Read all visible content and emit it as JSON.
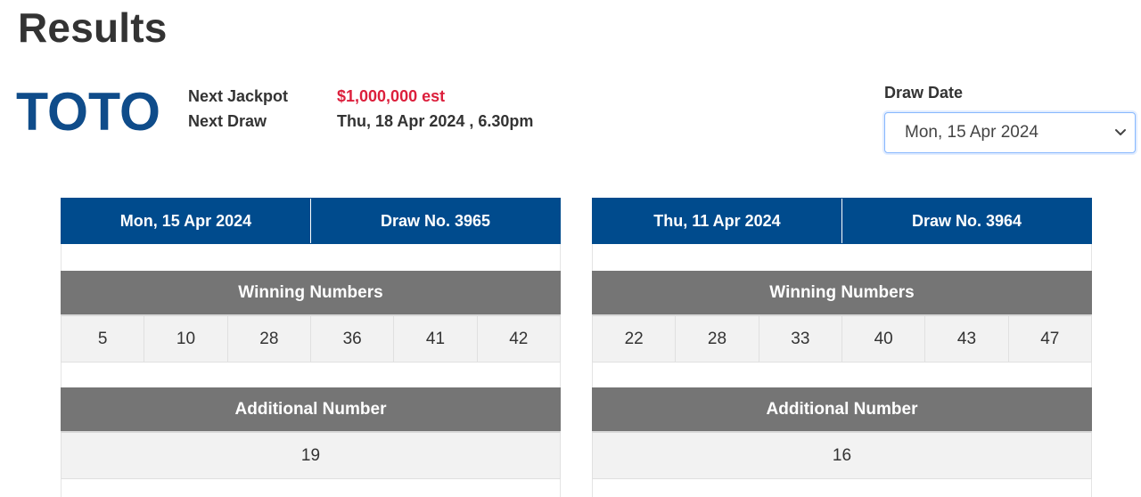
{
  "page": {
    "title": "Results"
  },
  "brand": {
    "logo_text": "TOTO",
    "color": "#0f4c8a"
  },
  "info": {
    "next_jackpot_label": "Next Jackpot",
    "next_jackpot_value": "$1,000,000 est",
    "next_draw_label": "Next Draw",
    "next_draw_value": "Thu, 18 Apr 2024 , 6.30pm"
  },
  "draw_date": {
    "label": "Draw Date",
    "selected": "Mon, 15 Apr 2024"
  },
  "draws": [
    {
      "date": "Mon, 15 Apr 2024",
      "draw_no": "Draw No. 3965",
      "winning_label": "Winning Numbers",
      "winning_numbers": [
        "5",
        "10",
        "28",
        "36",
        "41",
        "42"
      ],
      "additional_label": "Additional Number",
      "additional_number": "19"
    },
    {
      "date": "Thu, 11 Apr 2024",
      "draw_no": "Draw No. 3964",
      "winning_label": "Winning Numbers",
      "winning_numbers": [
        "22",
        "28",
        "33",
        "40",
        "43",
        "47"
      ],
      "additional_label": "Additional Number",
      "additional_number": "16"
    }
  ],
  "colors": {
    "header_blue": "#004b8d",
    "section_gray": "#757575",
    "jackpot_red": "#dc1f3c"
  }
}
